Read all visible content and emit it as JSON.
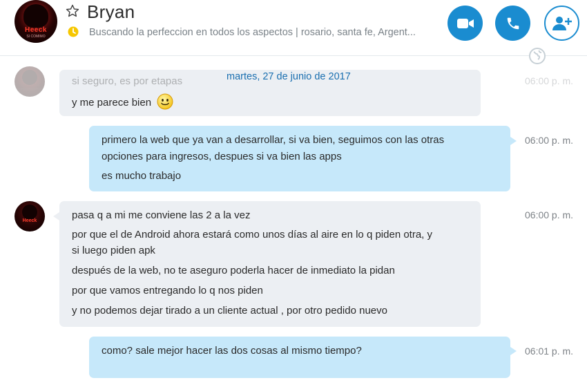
{
  "header": {
    "contact_name": "Bryan",
    "mood_message": "Buscando la perfeccion en todos los aspectos  |  rosario, santa fe, Argent...",
    "avatar_logo": "Heeck",
    "avatar_logo_sub": "SI COMIMO"
  },
  "chat": {
    "date_separator": "martes, 27 de junio de 2017",
    "messages": [
      {
        "direction": "in",
        "lines": [
          "si seguro, es por etapas"
        ],
        "time": "06:00 p. m.",
        "faded": true
      },
      {
        "direction": "in",
        "lines": [
          "y me parece bien"
        ],
        "emoji": "smiley-icon"
      },
      {
        "direction": "out",
        "lines": [
          "primero la web que ya van a desarrollar, si va bien, seguimos con las otras",
          "opciones para ingresos, despues si va bien las apps",
          "es mucho trabajo"
        ],
        "time": "06:00 p. m."
      },
      {
        "direction": "in",
        "lines": [
          "pasa q a mi me conviene las 2 a la vez",
          "por que el de Android ahora estará como unos días al aire en lo q piden otra, y",
          "si luego piden apk",
          "después de la web, no te aseguro poderla hacer de inmediato la pidan",
          "por que vamos entregando lo q nos piden",
          "y no podemos dejar tirado a un cliente actual , por otro pedido nuevo"
        ],
        "time": "06:00 p. m."
      },
      {
        "direction": "out",
        "lines": [
          "como? sale mejor hacer las dos cosas al mismo tiempo?"
        ],
        "time": "06:01 p. m."
      }
    ]
  },
  "colors": {
    "accent": "#1a8cd0",
    "incoming_bubble": "#eceff3",
    "outgoing_bubble": "#c6e8fa",
    "date_text": "#1a6fb0"
  },
  "icons": [
    "star-icon",
    "clock-icon",
    "video-call-icon",
    "audio-call-icon",
    "add-people-icon",
    "globe-icon",
    "smiley-icon"
  ]
}
